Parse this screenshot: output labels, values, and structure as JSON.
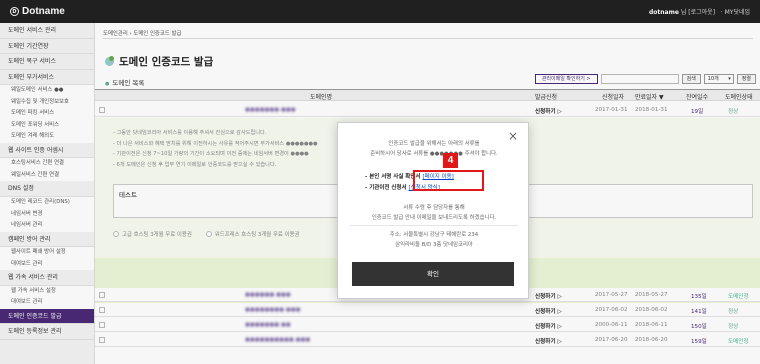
{
  "brand": {
    "logo_mark": "D",
    "name": "Dotname"
  },
  "topbar": {
    "user_name": "dotname",
    "user_suffix": " 님 [로그아웃]",
    "my_link": "· MY닷네임"
  },
  "sidebar": {
    "items": [
      {
        "label": "도메인 서비스 관리",
        "type": "item"
      },
      {
        "label": "도메인 기간연장",
        "type": "item"
      },
      {
        "label": "도메인 복구 서비스",
        "type": "item"
      },
      {
        "label": "도메인 부가서비스",
        "type": "item"
      },
      {
        "label": "웨일도메인 서비스 ●●",
        "type": "sub"
      },
      {
        "label": "웨일수집 및 개인정보보호",
        "type": "sub"
      },
      {
        "label": "도메인 파킹 서비스",
        "type": "sub"
      },
      {
        "label": "도메인 포워딩 서비스",
        "type": "sub"
      },
      {
        "label": "도메인 겨레 해외도",
        "type": "sub"
      },
      {
        "label": "웹 사이트 인증 어셈시",
        "type": "item"
      },
      {
        "label": "호스팅서비스 간편 연결",
        "type": "sub"
      },
      {
        "label": "웨일서비스 간편 연결",
        "type": "sub"
      },
      {
        "label": "DNS 설정",
        "type": "item"
      },
      {
        "label": "도메인 레코드 관리(DNS)",
        "type": "sub"
      },
      {
        "label": "네임서버 변경",
        "type": "sub"
      },
      {
        "label": "네임서버 관리",
        "type": "sub"
      },
      {
        "label": "캠페인 방어 관리",
        "type": "item"
      },
      {
        "label": "웹사이트 폐쇄 방어 설정",
        "type": "sub"
      },
      {
        "label": "대여보드 관리",
        "type": "sub"
      },
      {
        "label": "웹 가속 서비스 관리",
        "type": "item"
      },
      {
        "label": "웹 가속 서비스 설정",
        "type": "sub"
      },
      {
        "label": "대여보드 관리",
        "type": "sub"
      },
      {
        "label": "도메인 인증코드 발급",
        "type": "active"
      },
      {
        "label": "도메인 등록정보 관리",
        "type": "item"
      }
    ]
  },
  "breadcrumb": "도메인관리 › 도메인 인증코드 발급",
  "page_title": "도메인 인증코드 발급",
  "subhead": "도메인 목록",
  "toolbar": {
    "confirm_btn": "관리이메일 확인하기 >",
    "search_btn": "검색",
    "select_value": "10개",
    "apply_btn": "정렬"
  },
  "table": {
    "headers": [
      "도메인명",
      "발급신청",
      "신청일자",
      "만료일자 ▼",
      "잔여일수",
      "도메인상태"
    ],
    "rows_top": [
      {
        "domain": "●●●●●●●.●●●",
        "status": "신청하기 ▷",
        "applied": "2017-01-31",
        "expires": "2018-01-31",
        "days": "19일",
        "state": "정상"
      }
    ],
    "rows_bottom": [
      {
        "domain": "●●●●●●.●●●",
        "status": "신청하기 ▷",
        "applied": "2017-05-27",
        "expires": "2018-05-27",
        "days": "135일",
        "state": "도메인정"
      },
      {
        "domain": "●●●●●●●●.●●●",
        "status": "신청하기 ▷",
        "applied": "2017-06-02",
        "expires": "2018-06-02",
        "days": "141일",
        "state": "정상"
      },
      {
        "domain": "●●●●●●●.●●",
        "status": "신청하기 ▷",
        "applied": "2000-06-11",
        "expires": "2018-06-11",
        "days": "150일",
        "state": "정상"
      },
      {
        "domain": "●●●●●●●●●●.●●●",
        "status": "신청하기 ▷",
        "applied": "2017-06-20",
        "expires": "2018-06-20",
        "days": "159일",
        "state": "도메인정"
      }
    ]
  },
  "expanded": {
    "notes": [
      "- 그동안 닷네임코리아 서비스를 이용해 주셔서 진심으로 감사드립니다.",
      "- 더 나은 서비스와 혜택 받치를 위해 이전하시는 사유를 적어주시면 부가서비스 ●●●●●●●",
      "- 기관이전은 신청 7~10일 가량의 기간이 소요되며 이전 중에는 네임서버 변경이 ●●●●",
      "- 6개 도메인은 신청 후 업무 연기 이메일로 인증코드를 받으실 수 있습니다."
    ],
    "textarea_value": "테스트",
    "radio_a": "고급 호스팅 3개월 무료 이용권",
    "radio_b": "워드프레스 호스팅 3개월 무료 이용권"
  },
  "modal": {
    "line1a": "인증코드 발급을 위해서는 아래의 서류를",
    "line1b": "준비하시어 당사로 서류를 ●●●●●●● 주셔야 합니다.",
    "doc1_label": "- 본인 서명 사실 확인서",
    "doc1_link": "[페이지 이동]",
    "doc2_label": "- 기관이전 신청서",
    "doc2_link": "[신청서 양식]",
    "line2a": "서류 수령 후 담당자를 통해",
    "line2b": "인증코드 발급 안내 이메일을 보내드리도록 하겠습니다.",
    "line3a": "주소: 서울특별시 강남구 테헤란로 234",
    "line3b": "삼익라비돌 B/D 3층 닷네임코리아",
    "ok": "확인",
    "close": "×",
    "step_badge": "4"
  },
  "colors": {
    "accent": "#4b2a76",
    "highlight": "#e01818",
    "link": "#0044cc"
  }
}
